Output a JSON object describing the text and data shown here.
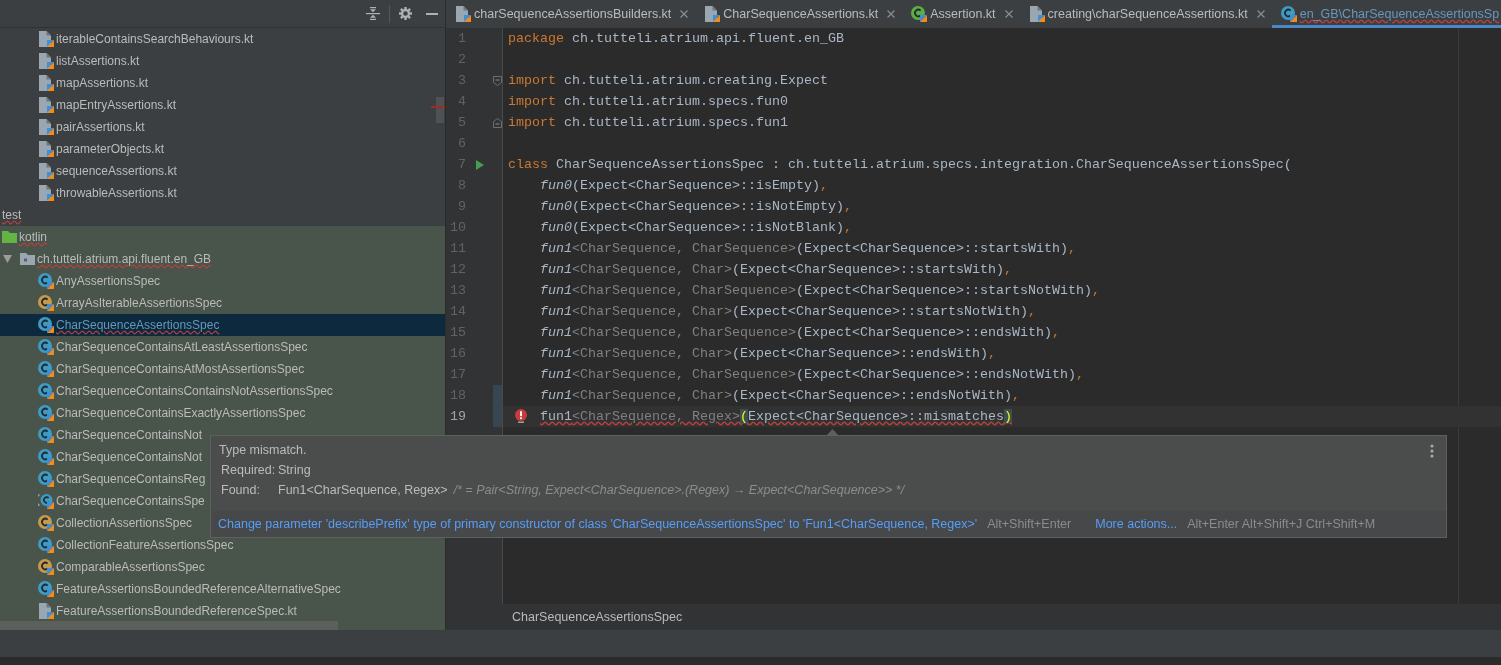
{
  "project_panel": {
    "upper_files": [
      {
        "label": "iterableContainsSearchBehaviours.kt",
        "kind": "kotlin-file",
        "selected": false,
        "modified": false,
        "error": false
      },
      {
        "label": "listAssertions.kt",
        "kind": "kotlin-file",
        "selected": false,
        "modified": false,
        "error": false
      },
      {
        "label": "mapAssertions.kt",
        "kind": "kotlin-file",
        "selected": false,
        "modified": false,
        "error": false
      },
      {
        "label": "mapEntryAssertions.kt",
        "kind": "kotlin-file",
        "selected": false,
        "modified": false,
        "error": false
      },
      {
        "label": "pairAssertions.kt",
        "kind": "kotlin-file",
        "selected": false,
        "modified": false,
        "error": false
      },
      {
        "label": "parameterObjects.kt",
        "kind": "kotlin-file",
        "selected": false,
        "modified": false,
        "error": false
      },
      {
        "label": "sequenceAssertions.kt",
        "kind": "kotlin-file",
        "selected": false,
        "modified": false,
        "error": false
      },
      {
        "label": "throwableAssertions.kt",
        "kind": "kotlin-file",
        "selected": false,
        "modified": false,
        "error": false
      }
    ],
    "nodes": [
      {
        "label": "test",
        "kind": "test-root",
        "selected": false,
        "modified": false,
        "error": true,
        "children": [
          {
            "label": "kotlin",
            "kind": "source-root",
            "selected": false,
            "modified": false,
            "error": true,
            "children": [
              {
                "label": "ch.tutteli.atrium.api.fluent.en_GB",
                "kind": "package",
                "expanded": true,
                "selected": false,
                "modified": false,
                "error": true,
                "children": [
                  {
                    "label": "AnyAssertionsSpec",
                    "kind": "class",
                    "selected": false,
                    "modified": false,
                    "error": false
                  },
                  {
                    "label": "ArrayAsIterableAssertionsSpec",
                    "kind": "abstract-class",
                    "selected": false,
                    "modified": false,
                    "error": false
                  },
                  {
                    "label": "CharSequenceAssertionsSpec",
                    "kind": "class",
                    "selected": true,
                    "modified": true,
                    "error": true
                  },
                  {
                    "label": "CharSequenceContainsAtLeastAssertionsSpec",
                    "kind": "class",
                    "selected": false,
                    "modified": false,
                    "error": false
                  },
                  {
                    "label": "CharSequenceContainsAtMostAssertionsSpec",
                    "kind": "class",
                    "selected": false,
                    "modified": false,
                    "error": false
                  },
                  {
                    "label": "CharSequenceContainsContainsNotAssertionsSpec",
                    "kind": "class",
                    "selected": false,
                    "modified": false,
                    "error": false
                  },
                  {
                    "label": "CharSequenceContainsExactlyAssertionsSpec",
                    "kind": "class",
                    "selected": false,
                    "modified": false,
                    "error": false
                  },
                  {
                    "label": "CharSequenceContainsNot",
                    "kind": "class",
                    "selected": false,
                    "modified": false,
                    "error": false
                  },
                  {
                    "label": "CharSequenceContainsNot",
                    "kind": "class",
                    "selected": false,
                    "modified": false,
                    "error": false
                  },
                  {
                    "label": "CharSequenceContainsReg",
                    "kind": "class",
                    "selected": false,
                    "modified": false,
                    "error": false
                  },
                  {
                    "label": "CharSequenceContainsSpe",
                    "kind": "class-variant",
                    "selected": false,
                    "modified": false,
                    "error": false
                  },
                  {
                    "label": "CollectionAssertionsSpec",
                    "kind": "abstract-class",
                    "selected": false,
                    "modified": false,
                    "error": false
                  },
                  {
                    "label": "CollectionFeatureAssertionsSpec",
                    "kind": "class",
                    "selected": false,
                    "modified": false,
                    "error": false
                  },
                  {
                    "label": "ComparableAssertionsSpec",
                    "kind": "abstract-class",
                    "selected": false,
                    "modified": false,
                    "error": false
                  },
                  {
                    "label": "FeatureAssertionsBoundedReferenceAlternativeSpec",
                    "kind": "class",
                    "selected": false,
                    "modified": false,
                    "error": false
                  },
                  {
                    "label": "FeatureAssertionsBoundedReferenceSpec.kt",
                    "kind": "kotlin-file",
                    "selected": false,
                    "modified": false,
                    "error": false
                  }
                ]
              }
            ]
          }
        ]
      }
    ]
  },
  "tabs": [
    {
      "label": "charSequenceAssertionsBuilders.kt",
      "kind": "kotlin-file",
      "selected": false,
      "modified": false,
      "error": false
    },
    {
      "label": "CharSequenceAssertions.kt",
      "kind": "kotlin-file",
      "selected": false,
      "modified": false,
      "error": false
    },
    {
      "label": "Assertion.kt",
      "kind": "interface",
      "selected": false,
      "modified": false,
      "error": false
    },
    {
      "label": "creating\\charSequenceAssertions.kt",
      "kind": "kotlin-file",
      "selected": false,
      "modified": false,
      "error": false
    },
    {
      "label": "en_GB\\CharSequenceAssertionsSp",
      "kind": "class",
      "selected": true,
      "modified": true,
      "error": true
    }
  ],
  "editor": {
    "lines": [
      {
        "number": "1",
        "kind": "code",
        "current": false,
        "changed": false,
        "error": false,
        "tokens": [
          {
            "text": "package",
            "kind": "keyword"
          },
          {
            "text": " ch.tutteli.atrium.api.fluent.en_GB",
            "kind": "plain"
          }
        ]
      },
      {
        "number": "2",
        "kind": "code",
        "current": false,
        "changed": false
      },
      {
        "number": "3",
        "kind": "fold-start",
        "current": false,
        "changed": false,
        "error": false,
        "tokens": [
          {
            "text": "import",
            "kind": "keyword"
          },
          {
            "text": " ch.tutteli.atrium.creating.Expect",
            "kind": "plain"
          }
        ]
      },
      {
        "number": "4",
        "kind": "code",
        "current": false,
        "changed": false,
        "error": false,
        "tokens": [
          {
            "text": "import",
            "kind": "keyword"
          },
          {
            "text": " ch.tutteli.atrium.specs.fun0",
            "kind": "plain"
          }
        ]
      },
      {
        "number": "5",
        "kind": "fold-end",
        "current": false,
        "changed": false,
        "error": false,
        "tokens": [
          {
            "text": "import",
            "kind": "keyword"
          },
          {
            "text": " ch.tutteli.atrium.specs.fun1",
            "kind": "plain"
          }
        ]
      },
      {
        "number": "6",
        "kind": "code",
        "current": false,
        "changed": false
      },
      {
        "number": "7",
        "kind": "run",
        "current": false,
        "changed": false,
        "error": false,
        "tokens": [
          {
            "text": "class",
            "kind": "keyword"
          },
          {
            "text": " CharSequenceAssertionsSpec : ch.tutteli.atrium.specs.integration.CharSequenceAssertionsSpec(",
            "kind": "plain"
          }
        ]
      },
      {
        "number": "8",
        "kind": "code",
        "current": false,
        "changed": false,
        "error": false,
        "tokens": [
          {
            "text": "    fun0",
            "kind": "call"
          },
          {
            "text": "(Expect<CharSequence>::isEmpty)",
            "kind": "plain"
          },
          {
            "text": ",",
            "kind": "comma"
          }
        ]
      },
      {
        "number": "9",
        "kind": "code",
        "current": false,
        "changed": false,
        "error": false,
        "tokens": [
          {
            "text": "    fun0",
            "kind": "call"
          },
          {
            "text": "(Expect<CharSequence>::isNotEmpty)",
            "kind": "plain"
          },
          {
            "text": ",",
            "kind": "comma"
          }
        ]
      },
      {
        "number": "10",
        "kind": "code",
        "current": false,
        "changed": false,
        "error": false,
        "tokens": [
          {
            "text": "    fun0",
            "kind": "call"
          },
          {
            "text": "(Expect<CharSequence>::isNotBlank)",
            "kind": "plain"
          },
          {
            "text": ",",
            "kind": "comma"
          }
        ]
      },
      {
        "number": "11",
        "kind": "code",
        "current": false,
        "changed": false,
        "error": false,
        "tokens": [
          {
            "text": "    fun1",
            "kind": "call"
          },
          {
            "text": "<CharSequence, CharSequence>",
            "kind": "type-args"
          },
          {
            "text": "(Expect<CharSequence>::startsWith)",
            "kind": "plain"
          },
          {
            "text": ",",
            "kind": "comma"
          }
        ]
      },
      {
        "number": "12",
        "kind": "code",
        "current": false,
        "changed": false,
        "error": false,
        "tokens": [
          {
            "text": "    fun1",
            "kind": "call"
          },
          {
            "text": "<CharSequence, Char>",
            "kind": "type-args"
          },
          {
            "text": "(Expect<CharSequence>::startsWith)",
            "kind": "plain"
          },
          {
            "text": ",",
            "kind": "comma"
          }
        ]
      },
      {
        "number": "13",
        "kind": "code",
        "current": false,
        "changed": false,
        "error": false,
        "tokens": [
          {
            "text": "    fun1",
            "kind": "call"
          },
          {
            "text": "<CharSequence, CharSequence>",
            "kind": "type-args"
          },
          {
            "text": "(Expect<CharSequence>::startsNotWith)",
            "kind": "plain"
          },
          {
            "text": ",",
            "kind": "comma"
          }
        ]
      },
      {
        "number": "14",
        "kind": "code",
        "current": false,
        "changed": false,
        "error": false,
        "tokens": [
          {
            "text": "    fun1",
            "kind": "call"
          },
          {
            "text": "<CharSequence, Char>",
            "kind": "type-args"
          },
          {
            "text": "(Expect<CharSequence>::startsNotWith)",
            "kind": "plain"
          },
          {
            "text": ",",
            "kind": "comma"
          }
        ]
      },
      {
        "number": "15",
        "kind": "code",
        "current": false,
        "changed": false,
        "error": false,
        "tokens": [
          {
            "text": "    fun1",
            "kind": "call"
          },
          {
            "text": "<CharSequence, CharSequence>",
            "kind": "type-args"
          },
          {
            "text": "(Expect<CharSequence>::endsWith)",
            "kind": "plain"
          },
          {
            "text": ",",
            "kind": "comma"
          }
        ]
      },
      {
        "number": "16",
        "kind": "code",
        "current": false,
        "changed": false,
        "error": false,
        "tokens": [
          {
            "text": "    fun1",
            "kind": "call"
          },
          {
            "text": "<CharSequence, Char>",
            "kind": "type-args"
          },
          {
            "text": "(Expect<CharSequence>::endsWith)",
            "kind": "plain"
          },
          {
            "text": ",",
            "kind": "comma"
          }
        ]
      },
      {
        "number": "17",
        "kind": "code",
        "current": false,
        "changed": false,
        "error": false,
        "tokens": [
          {
            "text": "    fun1",
            "kind": "call"
          },
          {
            "text": "<CharSequence, CharSequence>",
            "kind": "type-args"
          },
          {
            "text": "(Expect<CharSequence>::endsNotWith)",
            "kind": "plain"
          },
          {
            "text": ",",
            "kind": "comma"
          }
        ]
      },
      {
        "number": "18",
        "kind": "code",
        "current": false,
        "changed": true,
        "error": false,
        "tokens": [
          {
            "text": "    fun1",
            "kind": "call"
          },
          {
            "text": "<CharSequence, Char>",
            "kind": "type-args"
          },
          {
            "text": "(Expect<CharSequence>::endsNotWith)",
            "kind": "plain"
          },
          {
            "text": ",",
            "kind": "comma"
          }
        ]
      },
      {
        "number": "19",
        "kind": "error-bulb",
        "current": true,
        "changed": true,
        "error": true,
        "tokens": [
          {
            "text": "    fun1",
            "kind": "plain"
          },
          {
            "text": "<CharSequence, Regex>",
            "kind": "type-args"
          },
          {
            "text": "(",
            "kind": "brace-match"
          },
          {
            "text": "Expect<CharSequence>::mismatches",
            "kind": "plain"
          },
          {
            "text": ")",
            "kind": "brace-match"
          }
        ]
      }
    ],
    "breadcrumb": "CharSequenceAssertionsSpec"
  },
  "error_tooltip": {
    "title": "Type mismatch.",
    "rows": [
      {
        "label": "Required:",
        "value": "String"
      },
      {
        "label": "Found:",
        "value": "Fun1<CharSequence, Regex>",
        "comment": "/* = Pair<String, Expect<CharSequence>.(Regex) → Expect<CharSequence>> */"
      }
    ],
    "actions": [
      {
        "text": "Change parameter 'describePrefix' type of primary constructor of class 'CharSequenceAssertionsSpec' to 'Fun1<CharSequence, Regex>'",
        "shortcut": "Alt+Shift+Enter"
      },
      {
        "text": "More actions...",
        "shortcut": "Alt+Enter Alt+Shift+J Ctrl+Shift+M"
      }
    ]
  }
}
